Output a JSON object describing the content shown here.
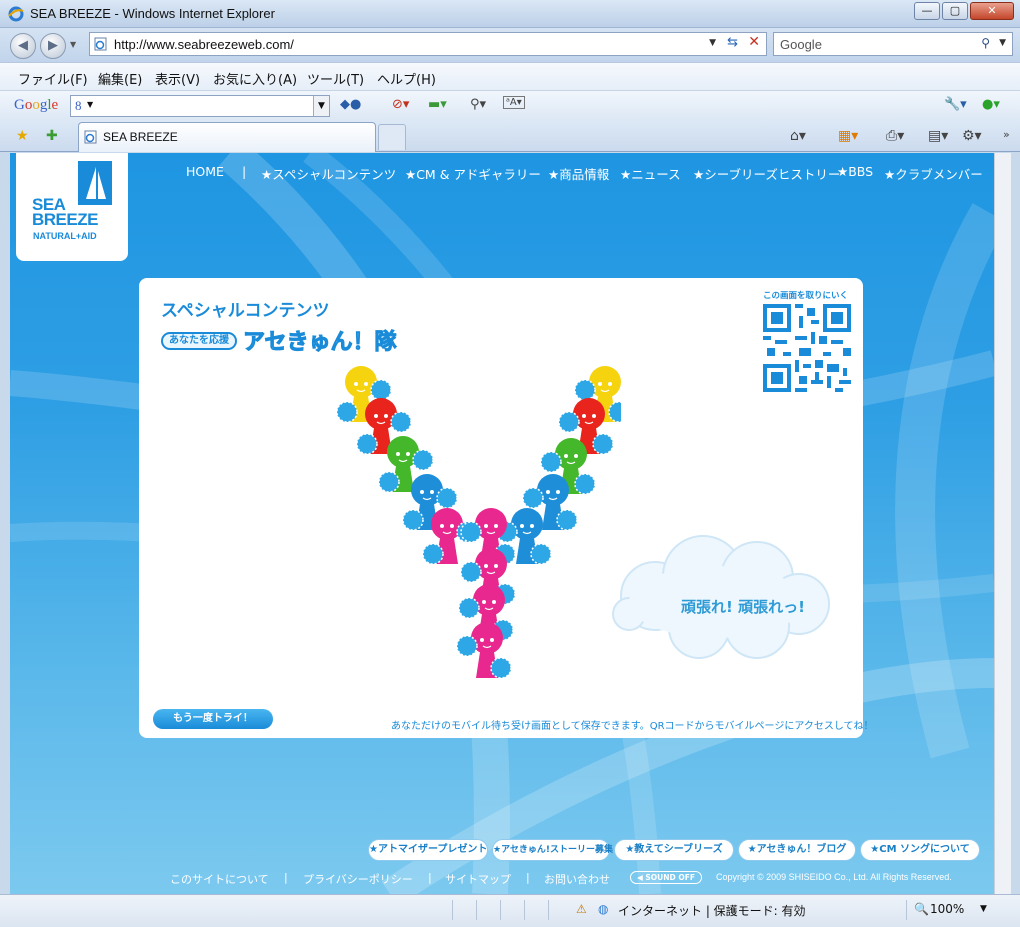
{
  "window": {
    "title": "SEA BREEZE - Windows Internet Explorer",
    "minimize": "—",
    "maximize": "▢",
    "close": "✕"
  },
  "address": {
    "url": "http://www.seabreezeweb.com/",
    "search_placeholder": "Google"
  },
  "menu": [
    "ファイル(F)",
    "編集(E)",
    "表示(V)",
    "お気に入り(A)",
    "ツール(T)",
    "ヘルプ(H)"
  ],
  "googlebar": {
    "logo": "Google",
    "input_value": "8"
  },
  "tab": {
    "label": "SEA BREEZE"
  },
  "site": {
    "brand": {
      "line1": "SEA",
      "line2": "BREEZE",
      "sub": "NATURAL+AID"
    },
    "nav": [
      "HOME",
      "|",
      "★スペシャルコンテンツ",
      "★CM & アドギャラリー",
      "★商品情報",
      "★ニュース",
      "★シーブリーズヒストリー",
      "★BBS",
      "★クラブメンバー"
    ],
    "panel": {
      "title": "スペシャルコンテンツ",
      "badge": "あなたを応援",
      "team": "アセきゅん！隊",
      "qr_label": "この画面を取りにいく",
      "cheer": "頑張れ! 頑張れっ!",
      "retry": "もう一度トライ！",
      "note": "あなただけのモバイル待ち受け画面として保存できます。QRコードからモバイルページにアクセスしてね！"
    },
    "pills": [
      "★アトマイザープレゼント",
      "★アセきゅん!ストーリー募集",
      "★教えてシーブリーズ",
      "★アセきゅん！ブログ",
      "★CM ソングについて"
    ],
    "footer": [
      "このサイトについて",
      "|",
      "プライバシーポリシー",
      "|",
      "サイトマップ",
      "|",
      "お問い合わせ"
    ],
    "sound": "◀ SOUND OFF",
    "copyright": "Copyright © 2009 SHISEIDO Co., Ltd. All Rights Reserved."
  },
  "status": {
    "zone": "インターネット | 保護モード: 有効",
    "zoom": "100%"
  },
  "colors": {
    "brand_blue": "#1a8bd8",
    "sky": "#2f9fe4",
    "character_colors": [
      "#f5d30f",
      "#e8241c",
      "#45b72a",
      "#1f8ed8",
      "#e8288f"
    ]
  }
}
